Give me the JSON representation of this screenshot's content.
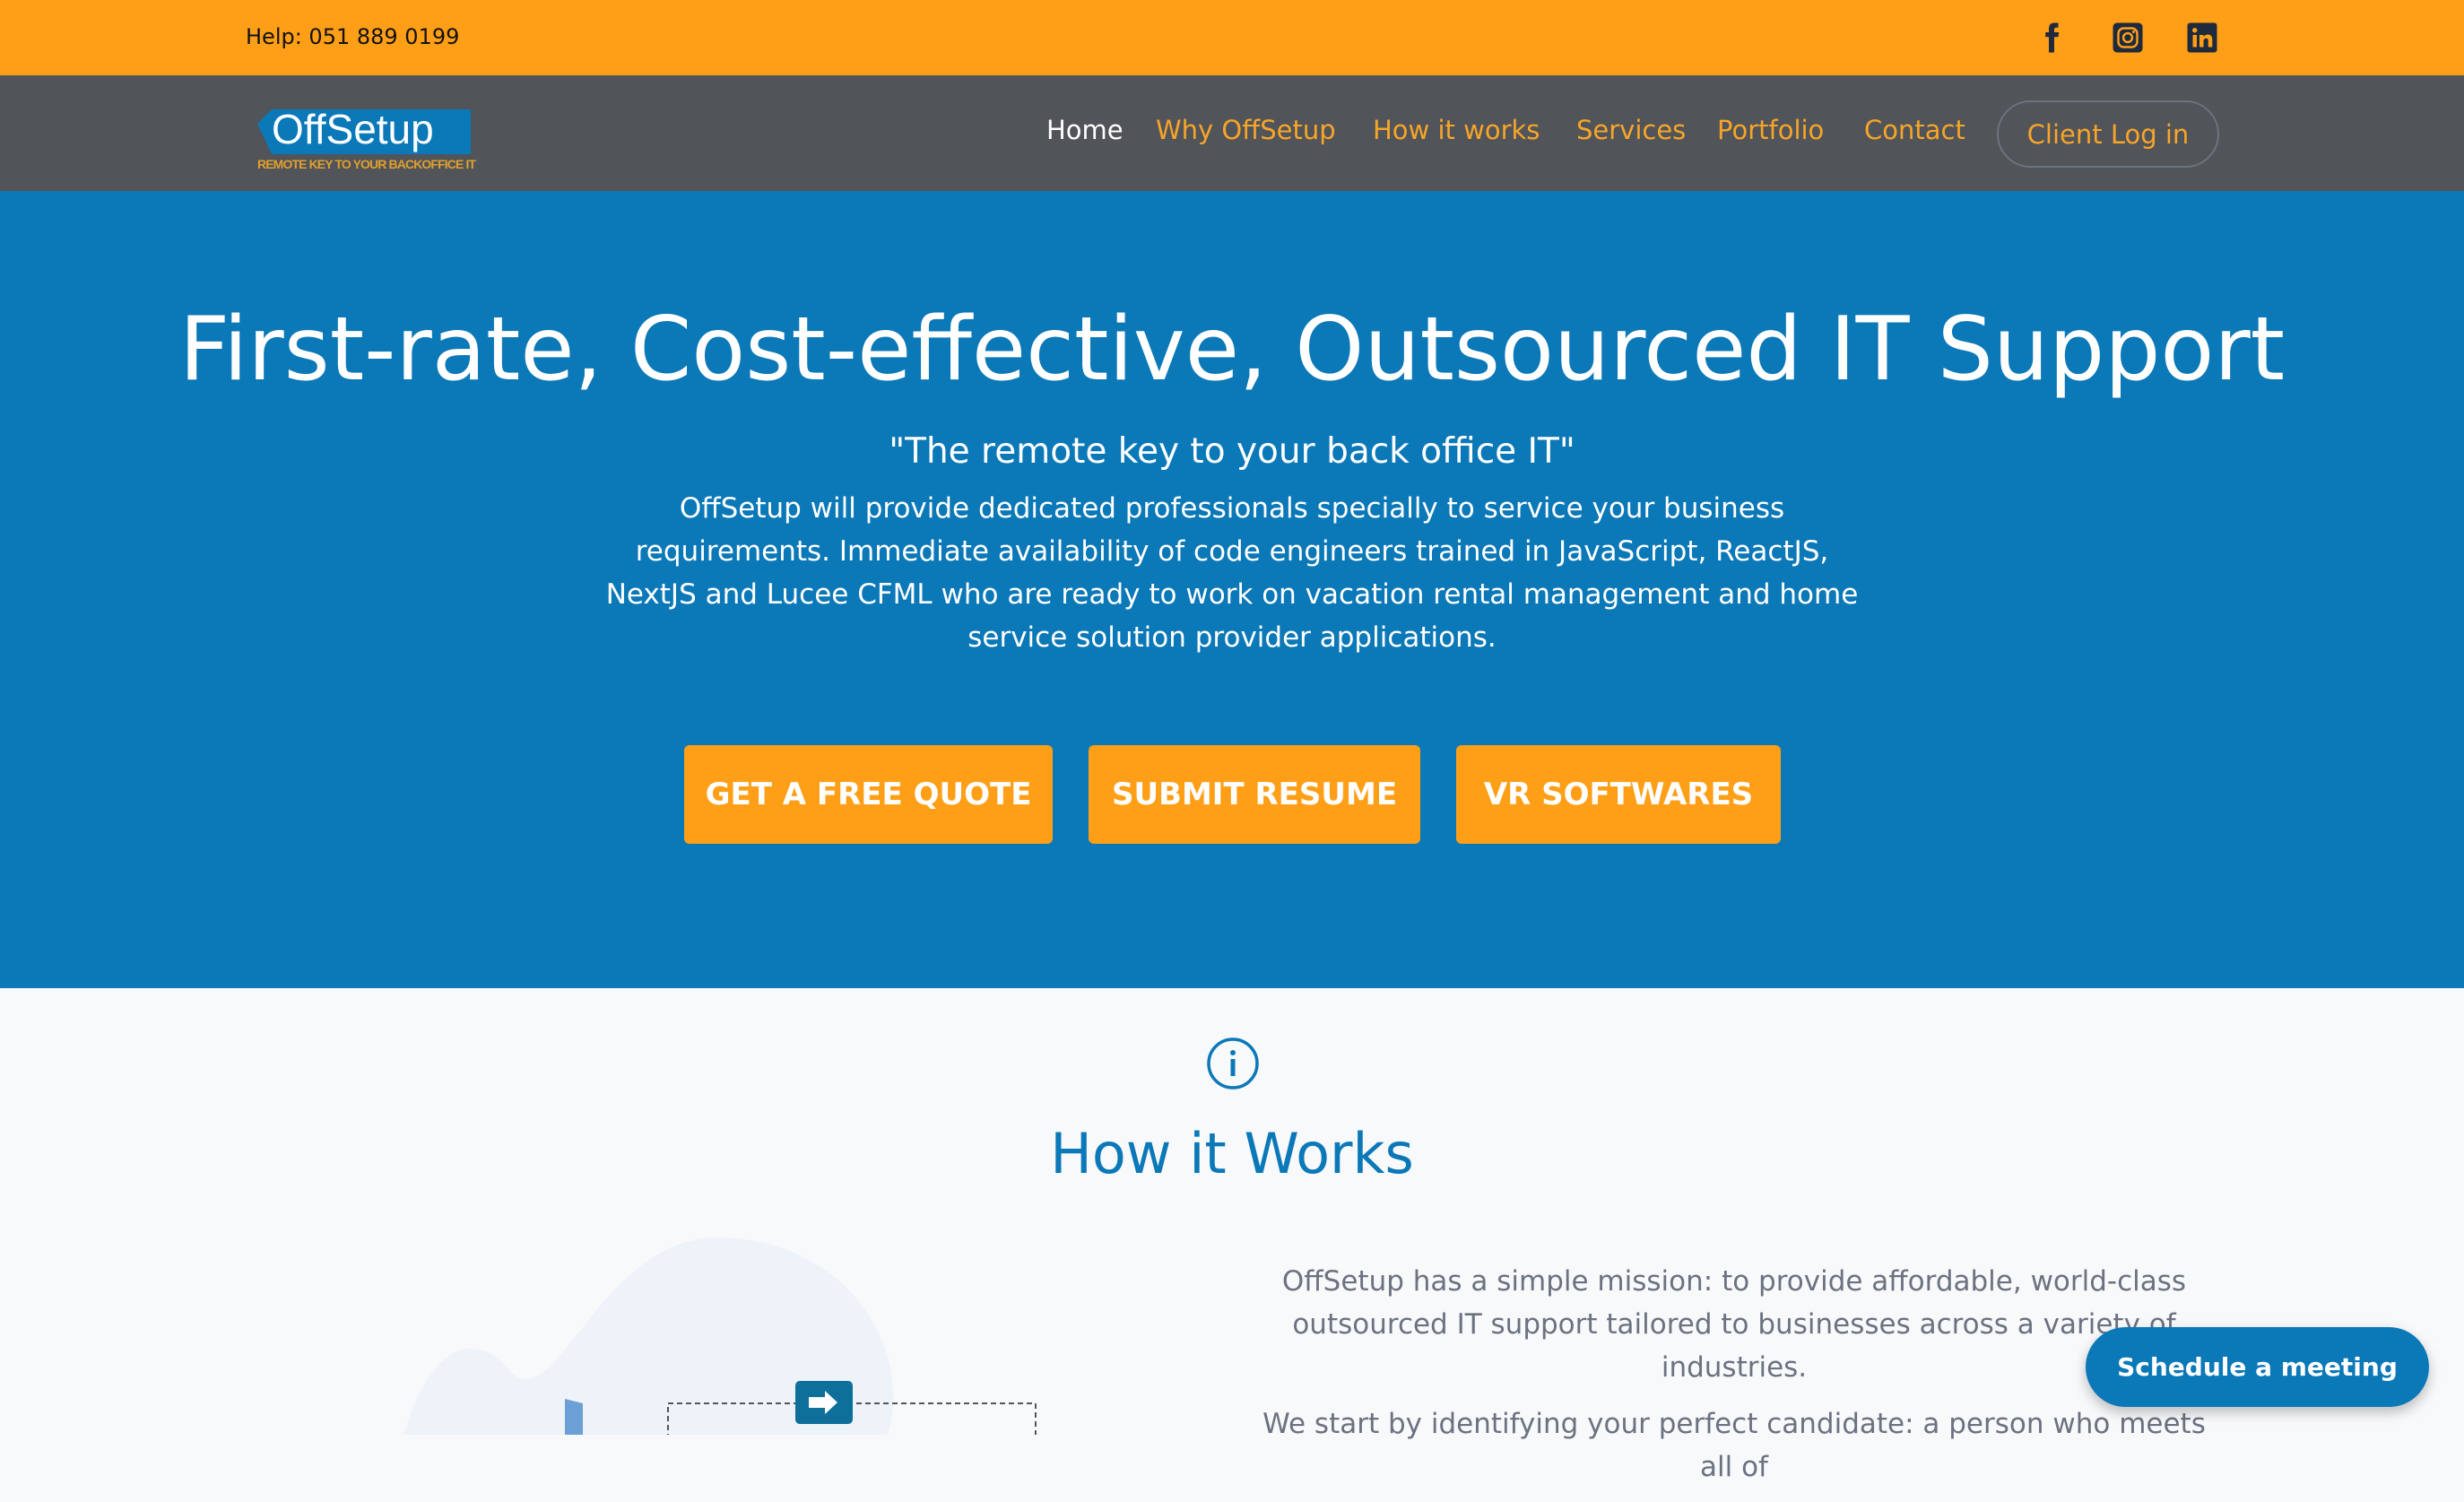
{
  "topbar": {
    "help": "Help: 051 889 0199",
    "social": [
      "facebook-icon",
      "instagram-icon",
      "linkedin-icon"
    ]
  },
  "logo": {
    "text_off": "Off",
    "text_setup": "Setup",
    "tagline": "REMOTE KEY TO YOUR BACKOFFICE IT"
  },
  "nav": {
    "items": [
      {
        "label": "Home"
      },
      {
        "label": "Why OffSetup"
      },
      {
        "label": "How it works"
      },
      {
        "label": "Services"
      },
      {
        "label": "Portfolio"
      },
      {
        "label": "Contact"
      }
    ],
    "login": "Client Log in"
  },
  "hero": {
    "title": "First-rate, Cost-effective, Outsourced IT Support",
    "subtitle": "\"The remote key to your back office IT\"",
    "description": "OffSetup will provide dedicated professionals specially to service your business requirements. Immediate availability of code engineers trained in JavaScript, ReactJS, NextJS and Lucee CFML who are ready to work on vacation rental management and home service solution provider applications.",
    "buttons": [
      "GET A FREE QUOTE",
      "SUBMIT RESUME",
      "VR SOFTWARES"
    ]
  },
  "how": {
    "title": "How it Works",
    "p1": "OffSetup has a simple mission: to provide affordable, world-class outsourced IT support tailored to businesses across a variety of industries.",
    "p2": "We start by identifying your perfect candidate: a person who meets all of"
  },
  "schedule": "Schedule a meeting",
  "colors": {
    "orange": "#ff9f17",
    "nav": "#515459",
    "blue": "#0b78b8"
  }
}
